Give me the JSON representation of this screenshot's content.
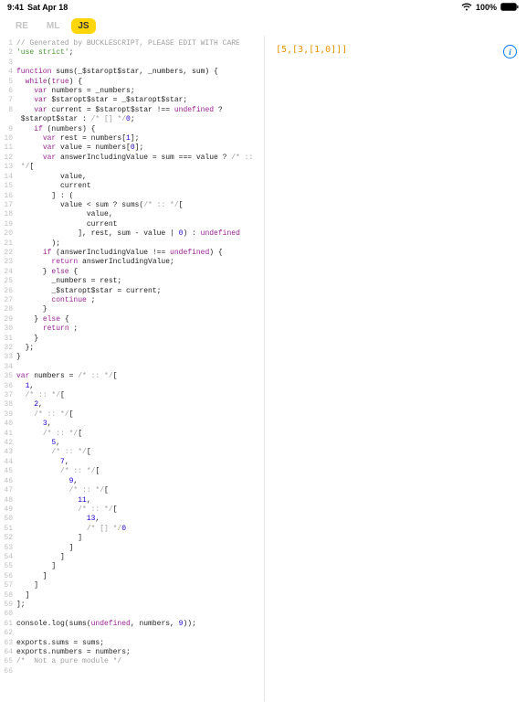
{
  "status": {
    "time": "9:41",
    "date": "Sat Apr 18",
    "battery_pct": "100%"
  },
  "tabs": [
    {
      "label": "RE",
      "active": false
    },
    {
      "label": "ML",
      "active": false
    },
    {
      "label": "JS",
      "active": true
    }
  ],
  "output": "[5,[3,[1,0]]]",
  "info_glyph": "i",
  "code_lines": [
    [
      {
        "t": "// Generated by BUCKLESCRIPT, PLEASE EDIT WITH CARE",
        "c": "c-comment"
      }
    ],
    [
      {
        "t": "'use strict'",
        "c": "c-string"
      },
      {
        "t": ";",
        "c": "c-ident"
      }
    ],
    [],
    [
      {
        "t": "function",
        "c": "c-keyword"
      },
      {
        "t": " sums(_$staropt$star, _numbers, sum) {",
        "c": "c-ident"
      }
    ],
    [
      {
        "t": "  ",
        "c": ""
      },
      {
        "t": "while",
        "c": "c-keyword"
      },
      {
        "t": "(",
        "c": "c-ident"
      },
      {
        "t": "true",
        "c": "c-keyword"
      },
      {
        "t": ") {",
        "c": "c-ident"
      }
    ],
    [
      {
        "t": "    ",
        "c": ""
      },
      {
        "t": "var",
        "c": "c-keyword"
      },
      {
        "t": " numbers = _numbers;",
        "c": "c-ident"
      }
    ],
    [
      {
        "t": "    ",
        "c": ""
      },
      {
        "t": "var",
        "c": "c-keyword"
      },
      {
        "t": " $staropt$star = _$staropt$star;",
        "c": "c-ident"
      }
    ],
    [
      {
        "t": "    ",
        "c": ""
      },
      {
        "t": "var",
        "c": "c-keyword"
      },
      {
        "t": " current = $staropt$star !== ",
        "c": "c-ident"
      },
      {
        "t": "undefined",
        "c": "c-undef"
      },
      {
        "t": " ?",
        "c": "c-ident"
      }
    ],
    [
      {
        "t": " $staropt$star : ",
        "c": "c-ident"
      },
      {
        "t": "/* [] */",
        "c": "c-comment"
      },
      {
        "t": "0",
        "c": "c-number"
      },
      {
        "t": ";",
        "c": "c-ident"
      }
    ],
    [
      {
        "t": "    ",
        "c": ""
      },
      {
        "t": "if",
        "c": "c-keyword"
      },
      {
        "t": " (numbers) {",
        "c": "c-ident"
      }
    ],
    [
      {
        "t": "      ",
        "c": ""
      },
      {
        "t": "var",
        "c": "c-keyword"
      },
      {
        "t": " rest = numbers[",
        "c": "c-ident"
      },
      {
        "t": "1",
        "c": "c-number"
      },
      {
        "t": "];",
        "c": "c-ident"
      }
    ],
    [
      {
        "t": "      ",
        "c": ""
      },
      {
        "t": "var",
        "c": "c-keyword"
      },
      {
        "t": " value = numbers[",
        "c": "c-ident"
      },
      {
        "t": "0",
        "c": "c-number"
      },
      {
        "t": "];",
        "c": "c-ident"
      }
    ],
    [
      {
        "t": "      ",
        "c": ""
      },
      {
        "t": "var",
        "c": "c-keyword"
      },
      {
        "t": " answerIncludingValue = sum === value ? ",
        "c": "c-ident"
      },
      {
        "t": "/* ::",
        "c": "c-comment"
      }
    ],
    [
      {
        "t": " */",
        "c": "c-comment"
      },
      {
        "t": "[",
        "c": "c-ident"
      }
    ],
    [
      {
        "t": "          value,",
        "c": "c-ident"
      }
    ],
    [
      {
        "t": "          current",
        "c": "c-ident"
      }
    ],
    [
      {
        "t": "        ] : (",
        "c": "c-ident"
      }
    ],
    [
      {
        "t": "          value < sum ? sums(",
        "c": "c-ident"
      },
      {
        "t": "/* :: */",
        "c": "c-comment"
      },
      {
        "t": "[",
        "c": "c-ident"
      }
    ],
    [
      {
        "t": "                value,",
        "c": "c-ident"
      }
    ],
    [
      {
        "t": "                current",
        "c": "c-ident"
      }
    ],
    [
      {
        "t": "              ], rest, sum - value | ",
        "c": "c-ident"
      },
      {
        "t": "0",
        "c": "c-number"
      },
      {
        "t": ") : ",
        "c": "c-ident"
      },
      {
        "t": "undefined",
        "c": "c-undef"
      }
    ],
    [
      {
        "t": "        );",
        "c": "c-ident"
      }
    ],
    [
      {
        "t": "      ",
        "c": ""
      },
      {
        "t": "if",
        "c": "c-keyword"
      },
      {
        "t": " (answerIncludingValue !== ",
        "c": "c-ident"
      },
      {
        "t": "undefined",
        "c": "c-undef"
      },
      {
        "t": ") {",
        "c": "c-ident"
      }
    ],
    [
      {
        "t": "        ",
        "c": ""
      },
      {
        "t": "return",
        "c": "c-keyword"
      },
      {
        "t": " answerIncludingValue;",
        "c": "c-ident"
      }
    ],
    [
      {
        "t": "      } ",
        "c": "c-ident"
      },
      {
        "t": "else",
        "c": "c-keyword"
      },
      {
        "t": " {",
        "c": "c-ident"
      }
    ],
    [
      {
        "t": "        _numbers = rest;",
        "c": "c-ident"
      }
    ],
    [
      {
        "t": "        _$staropt$star = current;",
        "c": "c-ident"
      }
    ],
    [
      {
        "t": "        ",
        "c": ""
      },
      {
        "t": "continue",
        "c": "c-keyword"
      },
      {
        "t": " ;",
        "c": "c-ident"
      }
    ],
    [
      {
        "t": "      }",
        "c": "c-ident"
      }
    ],
    [
      {
        "t": "    } ",
        "c": "c-ident"
      },
      {
        "t": "else",
        "c": "c-keyword"
      },
      {
        "t": " {",
        "c": "c-ident"
      }
    ],
    [
      {
        "t": "      ",
        "c": ""
      },
      {
        "t": "return",
        "c": "c-keyword"
      },
      {
        "t": " ;",
        "c": "c-ident"
      }
    ],
    [
      {
        "t": "    }",
        "c": "c-ident"
      }
    ],
    [
      {
        "t": "  };",
        "c": "c-ident"
      }
    ],
    [
      {
        "t": "}",
        "c": "c-ident"
      }
    ],
    [],
    [
      {
        "t": "var",
        "c": "c-keyword"
      },
      {
        "t": " numbers = ",
        "c": "c-ident"
      },
      {
        "t": "/* :: */",
        "c": "c-comment"
      },
      {
        "t": "[",
        "c": "c-ident"
      }
    ],
    [
      {
        "t": "  ",
        "c": ""
      },
      {
        "t": "1",
        "c": "c-number"
      },
      {
        "t": ",",
        "c": "c-ident"
      }
    ],
    [
      {
        "t": "  ",
        "c": ""
      },
      {
        "t": "/* :: */",
        "c": "c-comment"
      },
      {
        "t": "[",
        "c": "c-ident"
      }
    ],
    [
      {
        "t": "    ",
        "c": ""
      },
      {
        "t": "2",
        "c": "c-number"
      },
      {
        "t": ",",
        "c": "c-ident"
      }
    ],
    [
      {
        "t": "    ",
        "c": ""
      },
      {
        "t": "/* :: */",
        "c": "c-comment"
      },
      {
        "t": "[",
        "c": "c-ident"
      }
    ],
    [
      {
        "t": "      ",
        "c": ""
      },
      {
        "t": "3",
        "c": "c-number"
      },
      {
        "t": ",",
        "c": "c-ident"
      }
    ],
    [
      {
        "t": "      ",
        "c": ""
      },
      {
        "t": "/* :: */",
        "c": "c-comment"
      },
      {
        "t": "[",
        "c": "c-ident"
      }
    ],
    [
      {
        "t": "        ",
        "c": ""
      },
      {
        "t": "5",
        "c": "c-number"
      },
      {
        "t": ",",
        "c": "c-ident"
      }
    ],
    [
      {
        "t": "        ",
        "c": ""
      },
      {
        "t": "/* :: */",
        "c": "c-comment"
      },
      {
        "t": "[",
        "c": "c-ident"
      }
    ],
    [
      {
        "t": "          ",
        "c": ""
      },
      {
        "t": "7",
        "c": "c-number"
      },
      {
        "t": ",",
        "c": "c-ident"
      }
    ],
    [
      {
        "t": "          ",
        "c": ""
      },
      {
        "t": "/* :: */",
        "c": "c-comment"
      },
      {
        "t": "[",
        "c": "c-ident"
      }
    ],
    [
      {
        "t": "            ",
        "c": ""
      },
      {
        "t": "9",
        "c": "c-number"
      },
      {
        "t": ",",
        "c": "c-ident"
      }
    ],
    [
      {
        "t": "            ",
        "c": ""
      },
      {
        "t": "/* :: */",
        "c": "c-comment"
      },
      {
        "t": "[",
        "c": "c-ident"
      }
    ],
    [
      {
        "t": "              ",
        "c": ""
      },
      {
        "t": "11",
        "c": "c-number"
      },
      {
        "t": ",",
        "c": "c-ident"
      }
    ],
    [
      {
        "t": "              ",
        "c": ""
      },
      {
        "t": "/* :: */",
        "c": "c-comment"
      },
      {
        "t": "[",
        "c": "c-ident"
      }
    ],
    [
      {
        "t": "                ",
        "c": ""
      },
      {
        "t": "13",
        "c": "c-number"
      },
      {
        "t": ",",
        "c": "c-ident"
      }
    ],
    [
      {
        "t": "                ",
        "c": ""
      },
      {
        "t": "/* [] */",
        "c": "c-comment"
      },
      {
        "t": "0",
        "c": "c-number"
      }
    ],
    [
      {
        "t": "              ]",
        "c": "c-ident"
      }
    ],
    [
      {
        "t": "            ]",
        "c": "c-ident"
      }
    ],
    [
      {
        "t": "          ]",
        "c": "c-ident"
      }
    ],
    [
      {
        "t": "        ]",
        "c": "c-ident"
      }
    ],
    [
      {
        "t": "      ]",
        "c": "c-ident"
      }
    ],
    [
      {
        "t": "    ]",
        "c": "c-ident"
      }
    ],
    [
      {
        "t": "  ]",
        "c": "c-ident"
      }
    ],
    [
      {
        "t": "];",
        "c": "c-ident"
      }
    ],
    [],
    [
      {
        "t": "console.log(sums(",
        "c": "c-ident"
      },
      {
        "t": "undefined",
        "c": "c-undef"
      },
      {
        "t": ", numbers, ",
        "c": "c-ident"
      },
      {
        "t": "9",
        "c": "c-number"
      },
      {
        "t": "));",
        "c": "c-ident"
      }
    ],
    [],
    [
      {
        "t": "exports.sums = sums;",
        "c": "c-ident"
      }
    ],
    [
      {
        "t": "exports.numbers = numbers;",
        "c": "c-ident"
      }
    ],
    [
      {
        "t": "/*  Not a pure module */",
        "c": "c-comment"
      }
    ],
    []
  ],
  "line_renumber": {
    "8": 9
  }
}
